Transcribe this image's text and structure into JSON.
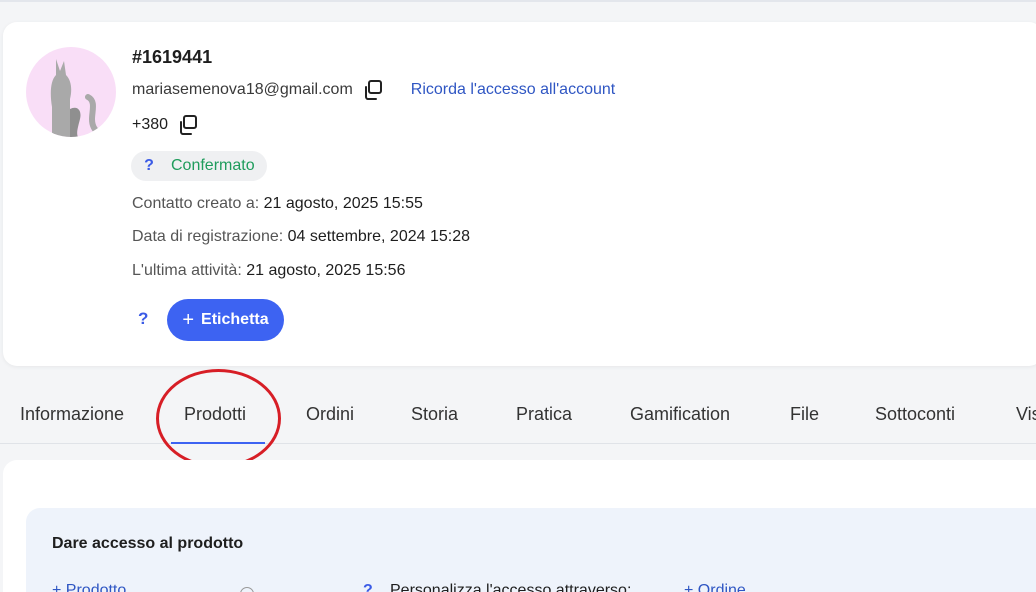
{
  "profile": {
    "id": "#1619441",
    "email": "mariasemenova18@gmail.com",
    "remember_link": "Ricorda l'accesso all'account",
    "phone": "+380",
    "status_q": "?",
    "status": "Confermato",
    "created_label": "Contatto creato a:",
    "created_value": "21 agosto, 2025 15:55",
    "registered_label": "Data di registrazione:",
    "registered_value": "04 settembre, 2024 15:28",
    "last_activity_label": "L'ultima attività:",
    "last_activity_value": "21 agosto, 2025 15:56",
    "help_q": "?",
    "tag_plus": "+",
    "tag_button": "Etichetta"
  },
  "tabs": [
    {
      "label": "Informazione"
    },
    {
      "label": "Prodotti",
      "active": true
    },
    {
      "label": "Ordini"
    },
    {
      "label": "Storia"
    },
    {
      "label": "Pratica"
    },
    {
      "label": "Gamification"
    },
    {
      "label": "File"
    },
    {
      "label": "Sottoconti"
    },
    {
      "label": "Vis"
    }
  ],
  "access": {
    "title": "Dare accesso al prodotto",
    "add_product": "+ Prodotto",
    "help_q": "?",
    "customize": "Personalizza l'accesso attraverso:",
    "add_order": "+ Ordine"
  },
  "colors": {
    "accent": "#3d63f2",
    "link": "#2f56c3",
    "confirmed": "#1f9c5c",
    "annotation": "#d71e26",
    "avatar_bg": "#f9def7"
  },
  "icons": {
    "copy": "copy-icon",
    "avatar": "cat-silhouette-icon"
  }
}
